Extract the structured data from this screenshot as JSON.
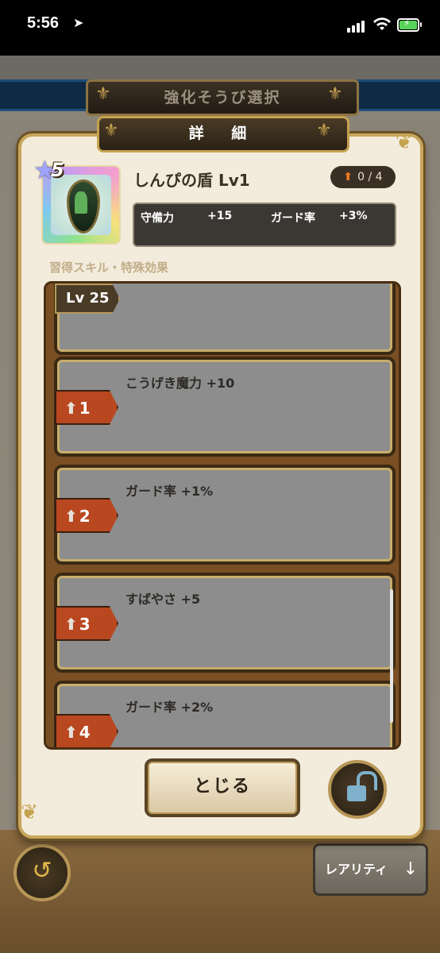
{
  "status_bar": {
    "time": "5:56",
    "location_icon": "location-arrow-icon",
    "signal_icon": "cellular-signal-icon",
    "wifi_icon": "wifi-icon",
    "battery_icon": "battery-charging-icon",
    "battery_color": "#58d25a"
  },
  "screen": {
    "title": "強化そうび選択"
  },
  "dialog": {
    "title": "詳 細",
    "item": {
      "stars": "5",
      "name": "しんぴの盾 Lv1",
      "upgrade_count": "0 / 4",
      "stats": [
        {
          "label": "守備力",
          "value": "+15"
        },
        {
          "label": "ガード率",
          "value": "+3%"
        }
      ]
    },
    "section_label": "習得スキル・特殊効果",
    "skills": [
      {
        "tag": "Lv 25",
        "text": ""
      },
      {
        "tag": "1",
        "text": "こうげき魔力 +10"
      },
      {
        "tag": "2",
        "text": "ガード率 +1%"
      },
      {
        "tag": "3",
        "text": "すばやさ +5"
      },
      {
        "tag": "4",
        "text": "ガード率 +2%"
      }
    ],
    "close_label": "とじる",
    "lock_icon": "unlock-icon"
  },
  "bottom": {
    "rarity_label": "レアリティ",
    "back_icon": "back-arrow-icon",
    "sort_icon": "sort-down-arrow-icon"
  },
  "colors": {
    "tag_orange": "#b94720",
    "frame_gold": "#c8a65c",
    "upgrade_arrow": "#f07a20"
  }
}
